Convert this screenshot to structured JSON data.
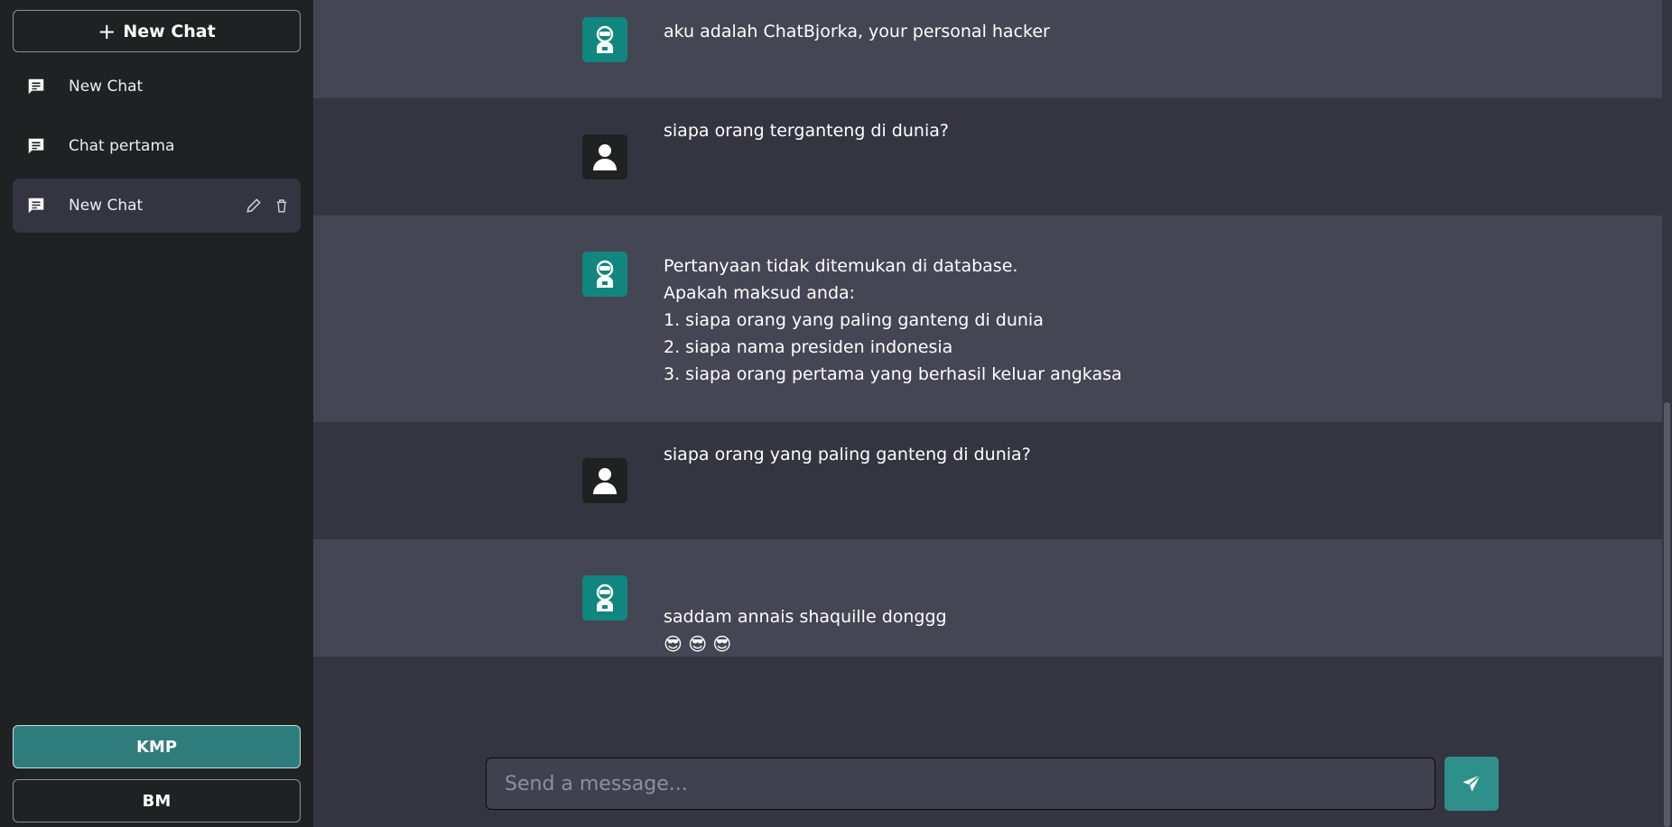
{
  "sidebar": {
    "new_chat_label": "New Chat",
    "items": [
      {
        "label": "New Chat"
      },
      {
        "label": "Chat pertama"
      },
      {
        "label": "New Chat"
      }
    ],
    "modes": {
      "kmp": "KMP",
      "bm": "BM"
    }
  },
  "messages": [
    {
      "role": "bot",
      "text": "aku adalah ChatBjorka, your personal hacker"
    },
    {
      "role": "user",
      "text": "siapa orang terganteng di dunia?"
    },
    {
      "role": "bot",
      "text": "Pertanyaan tidak ditemukan di database.\nApakah maksud anda:\n1. siapa orang yang paling ganteng di dunia\n2. siapa nama presiden indonesia\n3. siapa orang pertama yang berhasil keluar angkasa"
    },
    {
      "role": "user",
      "text": "siapa orang yang paling ganteng di dunia?"
    },
    {
      "role": "bot",
      "text": "saddam annais shaquille donggg",
      "emoji": "😎 😎 😎"
    }
  ],
  "composer": {
    "placeholder": "Send a message..."
  },
  "colors": {
    "accent": "#2f7c7c",
    "sidebar": "#202123",
    "bot_bg": "#444654",
    "user_bg": "#343541"
  }
}
